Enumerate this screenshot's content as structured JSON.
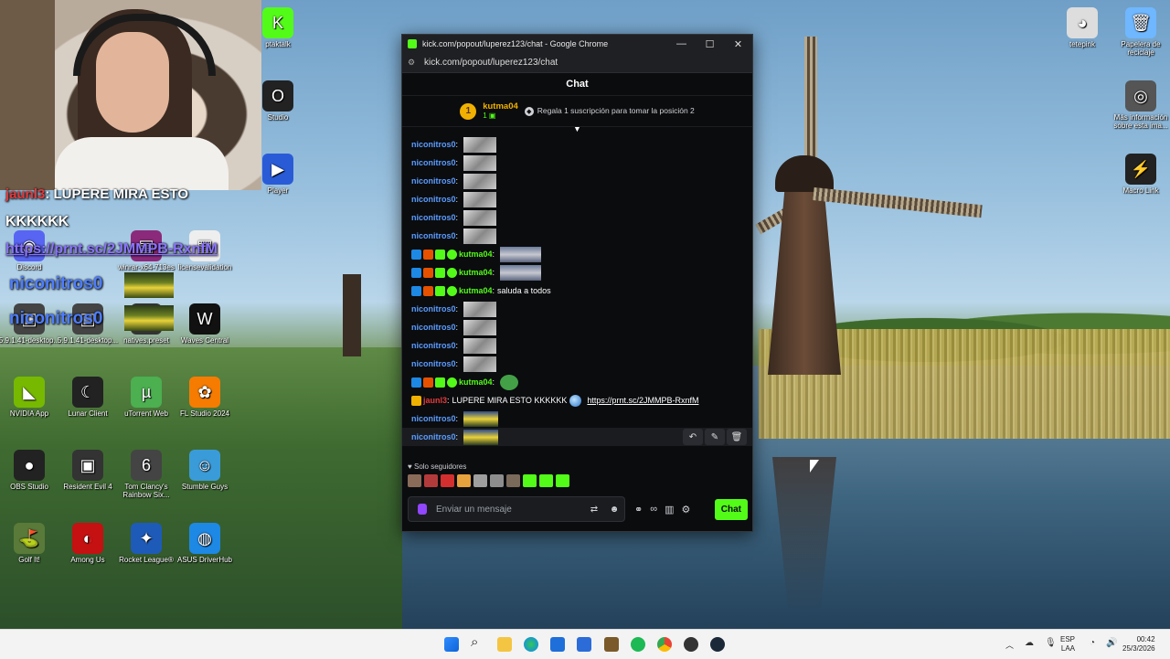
{
  "desktop": {
    "icons": [
      {
        "label": "ptaktalk",
        "glyph": "K",
        "color": "#53fc18"
      },
      {
        "label": "Studio",
        "glyph": "O",
        "color": "#222"
      },
      {
        "label": "Player",
        "glyph": "▶",
        "color": "#2a5bd7"
      },
      {
        "label": "Discord",
        "glyph": "◉",
        "color": "#5865f2"
      },
      {
        "label": "winrar-x64-713es",
        "glyph": "▤",
        "color": "#8b2a7a"
      },
      {
        "label": "licensevalidation",
        "glyph": "▦",
        "color": "#eee"
      },
      {
        "label": "5.9.1.41-desktop...",
        "glyph": "▣",
        "color": "#444"
      },
      {
        "label": "5.9.1.41-desktop...",
        "glyph": "▣",
        "color": "#444"
      },
      {
        "label": "natives.preset",
        "glyph": "▣",
        "color": "#333"
      },
      {
        "label": "Waves Central",
        "glyph": "W",
        "color": "#111"
      },
      {
        "label": "NVIDIA App",
        "glyph": "◣",
        "color": "#76b900"
      },
      {
        "label": "Lunar Client",
        "glyph": "☾",
        "color": "#222"
      },
      {
        "label": "uTorrent Web",
        "glyph": "µ",
        "color": "#4caf50"
      },
      {
        "label": "FL Studio 2024",
        "glyph": "✿",
        "color": "#f57c00"
      },
      {
        "label": "OBS Studio",
        "glyph": "●",
        "color": "#222"
      },
      {
        "label": "Resident Evil 4",
        "glyph": "▣",
        "color": "#333"
      },
      {
        "label": "Tom Clancy's Rainbow Six...",
        "glyph": "6",
        "color": "#444"
      },
      {
        "label": "Stumble Guys",
        "glyph": "☺",
        "color": "#3a9bd9"
      },
      {
        "label": "Golf It!",
        "glyph": "⛳",
        "color": "#5a7a3a"
      },
      {
        "label": "Among Us",
        "glyph": "◐",
        "color": "#c51111"
      },
      {
        "label": "Rocket League®",
        "glyph": "✦",
        "color": "#1e5bb8"
      },
      {
        "label": "ASUS DriverHub",
        "glyph": "◍",
        "color": "#1e88e5"
      },
      {
        "label": "tetepink",
        "glyph": "◕",
        "color": "#ddd"
      },
      {
        "label": "Papelera de reciclaje",
        "glyph": "🗑",
        "color": "#6fb7ff"
      },
      {
        "label": "Más información sobre esta ima...",
        "glyph": "◎",
        "color": "#555"
      },
      {
        "label": "Macro Link",
        "glyph": "⚡",
        "color": "#222"
      }
    ]
  },
  "overlay": {
    "line1_name": "jaunl3",
    "line1_text": ": LUPERE MIRA ESTO",
    "line2": "KKKKKK",
    "line3": "https://prnt.sc/2JMMPB-RxnfM",
    "line4": "niconitros0",
    "line5": "niconitros0"
  },
  "window": {
    "title": "kick.com/popout/luperez123/chat - Google Chrome",
    "address": "kick.com/popout/luperez123/chat",
    "minimize": "—",
    "maximize": "☐",
    "close": "✕"
  },
  "chat": {
    "header": "Chat",
    "pinned": {
      "rank": "1",
      "user": "kutma04",
      "count": "1",
      "cta": "Regala 1 suscripción para tomar la posición 2"
    },
    "messages": [
      {
        "user": "niconitros0",
        "text": "",
        "emote": "gray",
        "color": "#5b9cff"
      },
      {
        "user": "niconitros0",
        "text": "",
        "emote": "gray",
        "color": "#5b9cff"
      },
      {
        "user": "niconitros0",
        "text": "",
        "emote": "gray",
        "color": "#5b9cff"
      },
      {
        "user": "niconitros0",
        "text": "",
        "emote": "gray",
        "color": "#5b9cff"
      },
      {
        "user": "niconitros0",
        "text": "",
        "emote": "gray",
        "color": "#5b9cff"
      },
      {
        "user": "niconitros0",
        "text": "",
        "emote": "gray",
        "color": "#5b9cff"
      },
      {
        "user": "kutma04",
        "text": "",
        "emote": "wide",
        "color": "#53fc18",
        "badges": true
      },
      {
        "user": "kutma04",
        "text": "",
        "emote": "wide",
        "color": "#53fc18",
        "badges": true
      },
      {
        "user": "kutma04",
        "text": "saluda a todos",
        "emote": "",
        "color": "#53fc18",
        "badges": true
      },
      {
        "user": "niconitros0",
        "text": "",
        "emote": "gray",
        "color": "#5b9cff"
      },
      {
        "user": "niconitros0",
        "text": "",
        "emote": "gray",
        "color": "#5b9cff"
      },
      {
        "user": "niconitros0",
        "text": "",
        "emote": "gray",
        "color": "#5b9cff"
      },
      {
        "user": "niconitros0",
        "text": "",
        "emote": "gray",
        "color": "#5b9cff"
      },
      {
        "user": "kutma04",
        "text": "",
        "emote": "green",
        "color": "#53fc18",
        "badges": true
      },
      {
        "user": "jaunl3",
        "text": "LUPERE MIRA ESTO KKKKKK",
        "emote": "",
        "color": "#e23b3b",
        "link": "https://prnt.sc/2JMMPB-RxnfM",
        "gold": true
      },
      {
        "user": "niconitros0",
        "text": "",
        "emote": "yellow",
        "color": "#5b9cff"
      },
      {
        "user": "niconitros0",
        "text": "",
        "emote": "yellow",
        "color": "#5b9cff",
        "hover": true
      }
    ],
    "followers_only": "Solo seguidores",
    "input_placeholder": "Enviar un mensaje",
    "send_label": "Chat"
  },
  "tray": {
    "lang": "ESP",
    "region": "LAA",
    "time": "00:42",
    "date": "25/3/2026"
  }
}
